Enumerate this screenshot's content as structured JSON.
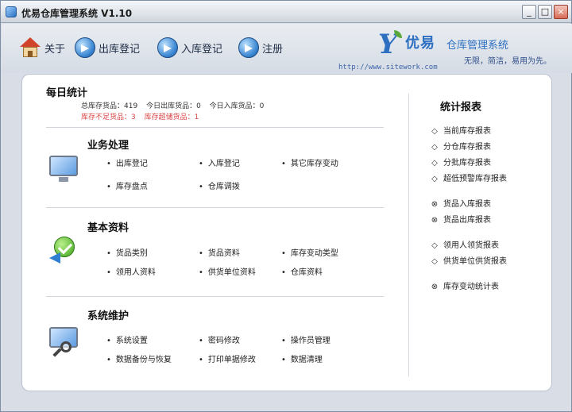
{
  "window": {
    "title": "优易仓库管理系统 V1.10",
    "controls": {
      "minimize": "_",
      "maximize": "□",
      "close": "×"
    }
  },
  "toolbar": {
    "items": [
      {
        "label": "关于",
        "icon": "home-icon"
      },
      {
        "label": "出库登记",
        "icon": "arrow-right-icon"
      },
      {
        "label": "入库登记",
        "icon": "arrow-in-icon"
      },
      {
        "label": "注册",
        "icon": "register-icon"
      }
    ]
  },
  "brand": {
    "mark": "Y",
    "name": "优易",
    "subtitle": "仓库管理系统",
    "slogan": "无限，简洁，易用为先。",
    "url": "http://www.sitework.com"
  },
  "daily": {
    "title": "每日统计",
    "stats1": [
      "总库存货品：419",
      "今日出库货品：0",
      "今日入库货品：0"
    ],
    "stats2": [
      "库存不足货品：3",
      "库存超储货品：1"
    ]
  },
  "sections": [
    {
      "title": "业务处理",
      "icon": "monitor-icon",
      "links": [
        "出库登记",
        "入库登记",
        "其它库存变动",
        "库存盘点",
        "仓库调拨"
      ]
    },
    {
      "title": "基本资料",
      "icon": "check-icon",
      "links": [
        "货品类别",
        "货品资料",
        "库存变动类型",
        "领用人资料",
        "供货单位资料",
        "仓库资料"
      ]
    },
    {
      "title": "系统维护",
      "icon": "search-icon",
      "links": [
        "系统设置",
        "密码修改",
        "操作员管理",
        "数据备份与恢复",
        "打印单据修改",
        "数据清理"
      ]
    }
  ],
  "reports": {
    "title": "统计报表",
    "items": [
      {
        "mark": "◇",
        "label": "当前库存报表"
      },
      {
        "mark": "◇",
        "label": "分仓库存报表"
      },
      {
        "mark": "◇",
        "label": "分批库存报表"
      },
      {
        "mark": "◇",
        "label": "超低预警库存报表"
      },
      {
        "mark": "⊗",
        "label": "货品入库报表"
      },
      {
        "mark": "⊗",
        "label": "货品出库报表"
      },
      {
        "mark": "◇",
        "label": "领用人领货报表"
      },
      {
        "mark": "◇",
        "label": "供货单位供货报表"
      },
      {
        "mark": "⊗",
        "label": "库存变动统计表"
      }
    ]
  }
}
